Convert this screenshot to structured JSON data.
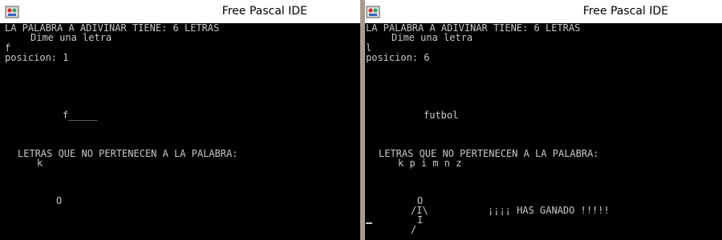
{
  "windows": [
    {
      "title": "Free Pascal IDE",
      "icon": "pascal-ide-icon",
      "lines": {
        "header": "LA PALABRA A ADIVINAR TIENE: 6 LETRAS",
        "prompt": "Dime una letra",
        "input": "f",
        "position": "posicion: 1",
        "word": "f_____",
        "wrong_label": "LETRAS QUE NO PERTENECEN A LA PALABRA:",
        "wrong_letters": "k",
        "hangman_head": "O"
      }
    },
    {
      "title": "Free Pascal IDE",
      "icon": "pascal-ide-icon",
      "lines": {
        "header": "LA PALABRA A ADIVINAR TIENE: 6 LETRAS",
        "prompt": "Dime una letra",
        "input": "l",
        "position": "posicion: 6",
        "word": "futbol",
        "wrong_label": "LETRAS QUE NO PERTENECEN A LA PALABRA:",
        "wrong_letters": "k p i m n z",
        "hangman_head": "O",
        "hangman_arms": "/I\\",
        "hangman_body": "I",
        "hangman_leg": "/",
        "win_message": "¡¡¡¡ HAS GANADO !!!!!"
      }
    }
  ]
}
